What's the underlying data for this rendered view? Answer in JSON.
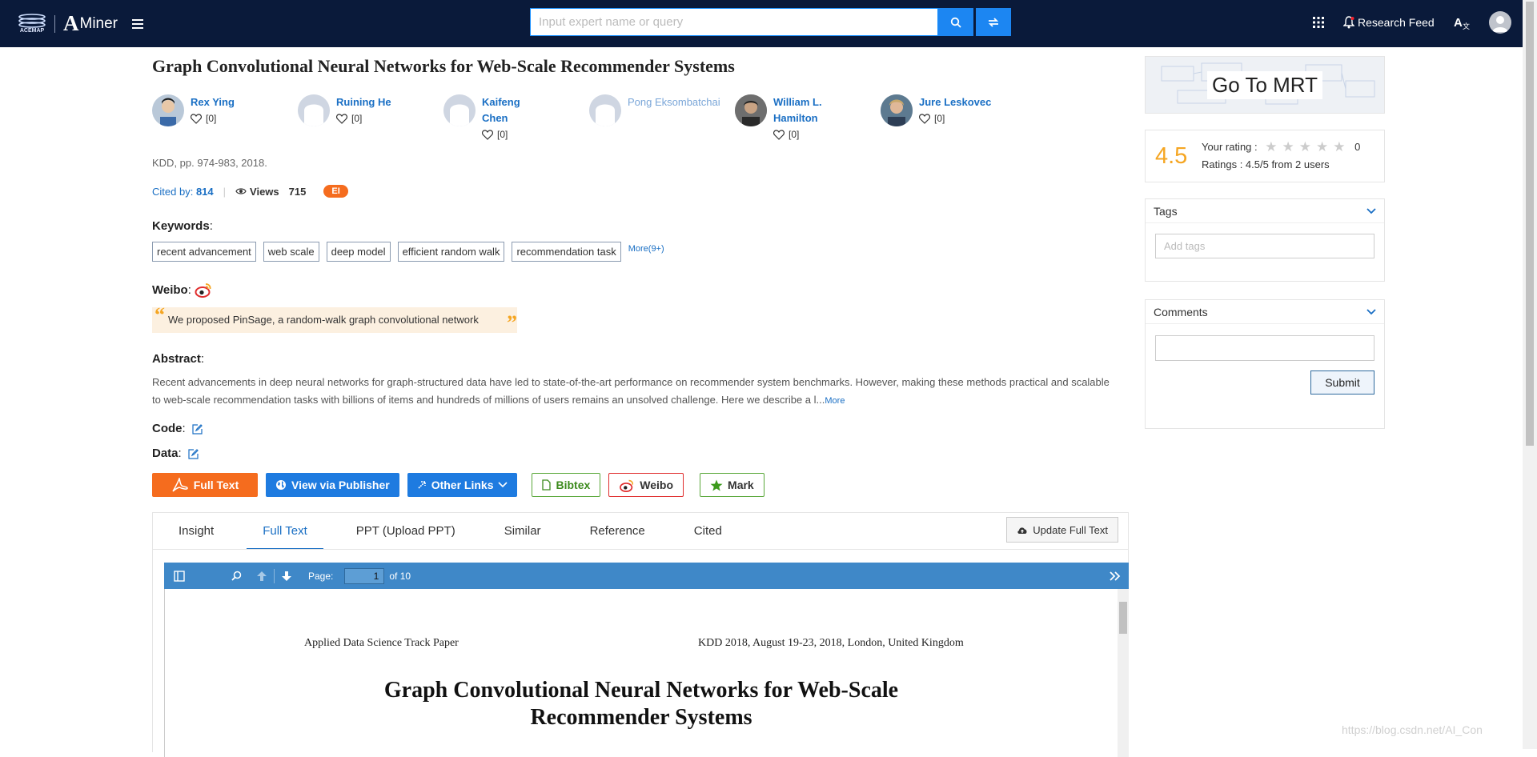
{
  "header": {
    "logo1_text": "ACEMAP",
    "logo2_text": "Miner",
    "search_placeholder": "Input expert name or query",
    "research_feed": "Research Feed"
  },
  "paper": {
    "title": "Graph Convolutional Neural Networks for Web-Scale Recommender Systems",
    "authors": [
      {
        "name": "Rex Ying",
        "likes": "[0]"
      },
      {
        "name": "Ruining He",
        "likes": "[0]"
      },
      {
        "name": "Kaifeng Chen",
        "likes": "[0]"
      },
      {
        "name": "Pong Eksombatchai",
        "likes": ""
      },
      {
        "name": "William L. Hamilton",
        "likes": "[0]"
      },
      {
        "name": "Jure Leskovec",
        "likes": "[0]"
      }
    ],
    "venue": "KDD, pp. 974-983, 2018.",
    "cited_label": "Cited by:",
    "cited_count": "814",
    "views_label": "Views",
    "views_count": "715",
    "badge": "EI",
    "keywords_label": "Keywords",
    "keywords": [
      "recent advancement",
      "web scale",
      "deep model",
      "efficient random walk",
      "recommendation task"
    ],
    "keywords_more": "More(9+)",
    "weibo_label": "Weibo",
    "weibo_quote": "We proposed PinSage, a random-walk graph convolutional network",
    "abstract_label": "Abstract",
    "abstract_text": "Recent advancements in deep neural networks for graph-structured data have led to state-of-the-art performance on recommender system benchmarks. However, making these methods practical and scalable to web-scale recommendation tasks with billions of items and hundreds of millions of users remains an unsolved challenge. Here we describe a l...",
    "abstract_more": "More",
    "code_label": "Code",
    "data_label": "Data"
  },
  "buttons": {
    "full_text": "Full Text",
    "publisher": "View via Publisher",
    "other_links": "Other Links",
    "bibtex": "Bibtex",
    "weibo": "Weibo",
    "mark": "Mark"
  },
  "tabs": {
    "items": [
      "Insight",
      "Full Text",
      "PPT (Upload PPT)",
      "Similar",
      "Reference",
      "Cited"
    ],
    "active": "Full Text",
    "update": "Update Full Text"
  },
  "pdf": {
    "page_label": "Page:",
    "page_value": "1",
    "page_total": "of 10",
    "header_left": "Applied Data Science Track Paper",
    "header_right": "KDD 2018, August 19-23, 2018, London, United Kingdom",
    "title_line1": "Graph Convolutional Neural Networks for Web-Scale",
    "title_line2": "Recommender Systems"
  },
  "sidebar": {
    "mrt": "Go To MRT",
    "rating_value": "4.5",
    "your_rating": "Your rating :",
    "your_rating_count": "0",
    "ratings_summary": "Ratings : 4.5/5 from 2 users",
    "tags_title": "Tags",
    "tags_placeholder": "Add tags",
    "comments_title": "Comments",
    "submit": "Submit"
  },
  "watermark": "https://blog.csdn.net/AI_Con",
  "colors": {
    "topbar": "#0a1a3a",
    "link": "#1a6fc4",
    "orange": "#f56c1e",
    "rating": "#f5a623"
  }
}
